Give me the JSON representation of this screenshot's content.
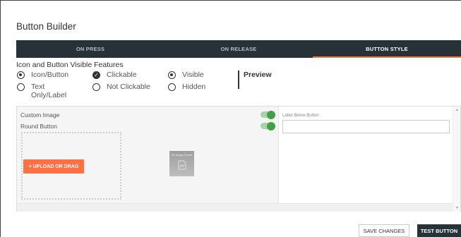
{
  "title": "Button Builder",
  "tabs": [
    {
      "label": "ON PRESS",
      "active": false
    },
    {
      "label": "ON RELEASE",
      "active": false
    },
    {
      "label": "BUTTON STYLE",
      "active": true
    }
  ],
  "features": {
    "heading": "Icon and Button Visible Features",
    "type_options": [
      {
        "label": "Icon/Button",
        "selected": true
      },
      {
        "label": "Text Only/Label",
        "selected": false
      }
    ],
    "click_options": [
      {
        "label": "Clickable",
        "selected": true
      },
      {
        "label": "Not Clickable",
        "selected": false
      }
    ],
    "visibility_options": [
      {
        "label": "Visible",
        "selected": true
      },
      {
        "label": "Hidden",
        "selected": false
      }
    ],
    "preview_label": "Preview"
  },
  "style_panel": {
    "custom_image_label": "Custom Image",
    "custom_image_enabled": true,
    "round_button_label": "Round Button",
    "round_button_enabled": true,
    "upload_button_label": "+ UPLOAD OR DRAG",
    "no_image_text": "No Image Found",
    "label_below_field_label": "Label Below Button",
    "label_below_value": ""
  },
  "footer": {
    "save_label": "SAVE CHANGES",
    "test_label": "TEST BUTTON"
  },
  "colors": {
    "tabbar": "#263238",
    "accent": "#ff7043",
    "toggle_on": "#43a047"
  }
}
